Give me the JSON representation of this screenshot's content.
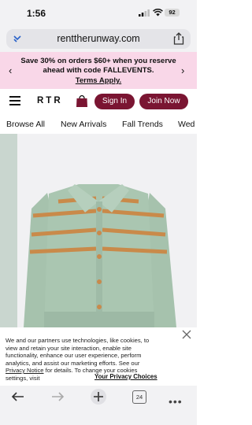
{
  "status_bar": {
    "time": "1:56",
    "battery": "92"
  },
  "browser": {
    "url": "renttherunway.com",
    "tab_count": "24"
  },
  "promo": {
    "line1": "Save 30% on orders $60+ when you reserve",
    "line2": "ahead with code FALLEVENTS.",
    "link": "Terms Apply."
  },
  "header": {
    "logo": "RTR",
    "sign_in": "Sign In",
    "join_now": "Join Now"
  },
  "nav": {
    "items": [
      "Browse All",
      "New Arrivals",
      "Fall Trends",
      "Wed"
    ]
  },
  "cookie": {
    "lines": [
      "We and our partners use technologies, like cookies, to",
      "view and retain your site interaction, enable site",
      "functionality, enhance our user experience, perform",
      "analytics, and assist our marketing efforts. See our"
    ],
    "privacy_link": "Privacy Notice",
    "line5_rest": " for details. To change your cookies",
    "line6": "settings, visit",
    "choices_link": "Your Privacy Choices"
  },
  "colors": {
    "brand": "#7a1532",
    "promo_bg": "#f9d7e8",
    "sweater": "#a9c4b0",
    "stripe": "#c98a4a"
  }
}
